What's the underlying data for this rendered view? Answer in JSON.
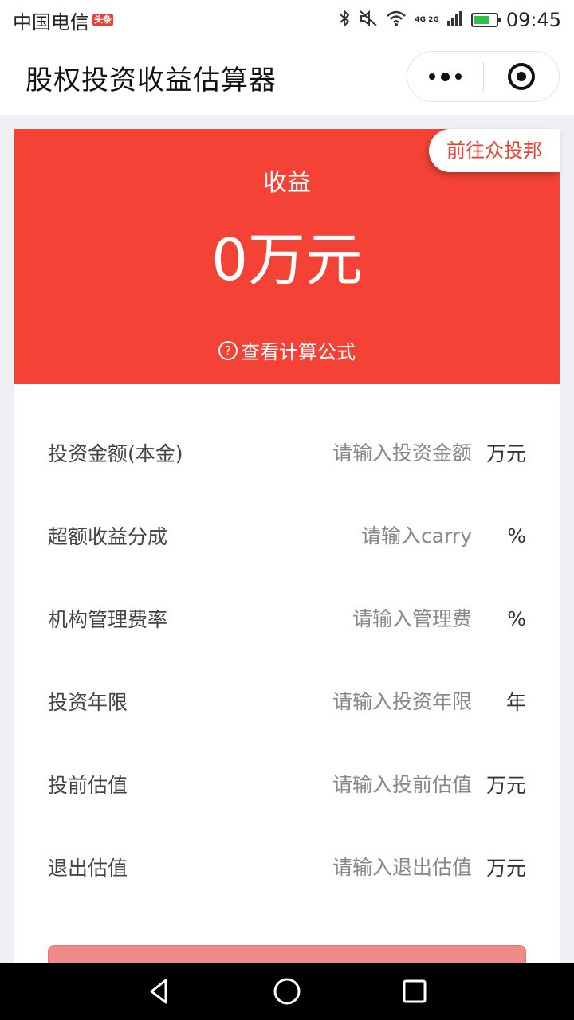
{
  "status_bar": {
    "carrier": "中国电信",
    "carrier_badge": "头条",
    "network": "4G 2G",
    "time": "09:45",
    "battery_fill_fraction": 0.7
  },
  "navbar": {
    "title": "股权投资收益估算器"
  },
  "hero": {
    "goto_label": "前往众投邦",
    "label": "收益",
    "value": "0万元",
    "formula_label": "查看计算公式",
    "help_glyph": "?"
  },
  "form": {
    "rows": [
      {
        "label": "投资金额(本金)",
        "placeholder": "请输入投资金额",
        "unit": "万元"
      },
      {
        "label": "超额收益分成",
        "placeholder": "请输入carry",
        "unit": "%"
      },
      {
        "label": "机构管理费率",
        "placeholder": "请输入管理费",
        "unit": "%"
      },
      {
        "label": "投资年限",
        "placeholder": "请输入投资年限",
        "unit": "年"
      },
      {
        "label": "投前估值",
        "placeholder": "请输入投前估值",
        "unit": "万元"
      },
      {
        "label": "退出估值",
        "placeholder": "请输入退出估值",
        "unit": "万元"
      }
    ]
  },
  "colors": {
    "accent": "#f44336",
    "button": "#ee8a88"
  }
}
